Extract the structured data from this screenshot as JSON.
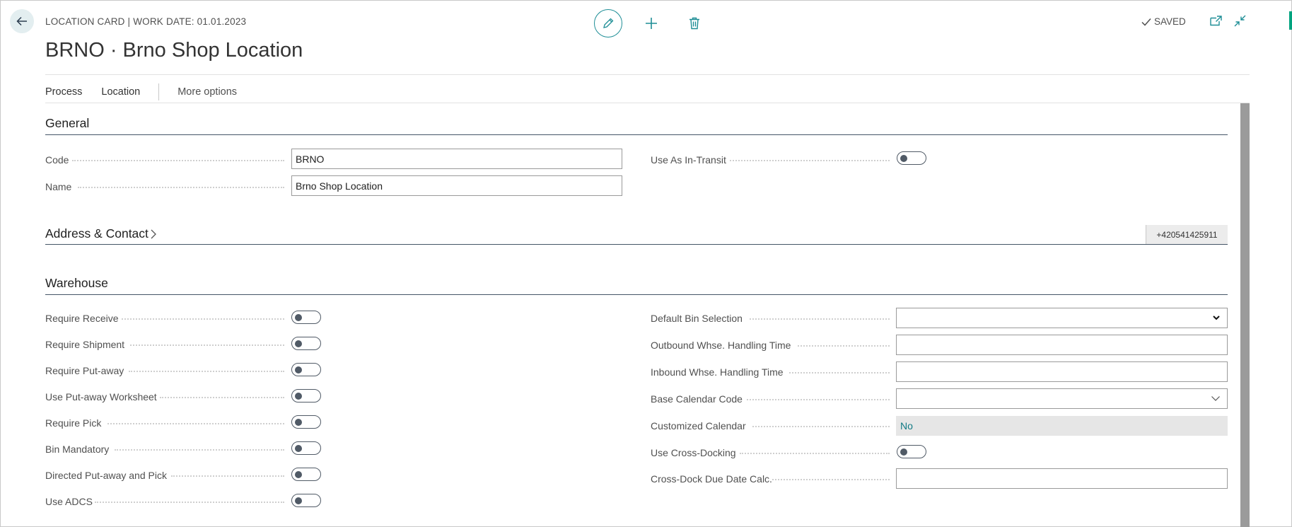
{
  "header": {
    "caption": "LOCATION CARD | WORK DATE: 01.01.2023",
    "title": "BRNO · Brno Shop Location",
    "status": "SAVED"
  },
  "icons": {
    "back": "arrow-left-icon",
    "edit": "pencil-icon",
    "new": "plus-icon",
    "delete": "trash-icon",
    "saved": "checkmark-icon",
    "open_new_window": "open-in-new-window-icon",
    "collapse": "collapse-icon",
    "dropdown": "chevron-down-icon",
    "expand": "chevron-right-icon"
  },
  "colors": {
    "accent": "#1e8e96",
    "section_line": "#445566",
    "link_value": "#127b85",
    "status_accent": "#00a37f"
  },
  "actionbar": {
    "process": "Process",
    "location": "Location",
    "more": "More options"
  },
  "general": {
    "title": "General",
    "code_label": "Code",
    "code_value": "BRNO",
    "name_label": "Name",
    "name_value": "Brno Shop Location",
    "in_transit_label": "Use As In-Transit",
    "in_transit_on": false
  },
  "address": {
    "title": "Address & Contact",
    "phone": "+420541425911"
  },
  "warehouse": {
    "title": "Warehouse",
    "left": [
      {
        "label": "Require Receive",
        "on": false
      },
      {
        "label": "Require Shipment",
        "on": false
      },
      {
        "label": "Require Put-away",
        "on": false
      },
      {
        "label": "Use Put-away Worksheet",
        "on": false
      },
      {
        "label": "Require Pick",
        "on": false
      },
      {
        "label": "Bin Mandatory",
        "on": false
      },
      {
        "label": "Directed Put-away and Pick",
        "on": false
      },
      {
        "label": "Use ADCS",
        "on": false
      }
    ],
    "right": {
      "default_bin_selection": {
        "label": "Default Bin Selection",
        "value": ""
      },
      "outbound_handling": {
        "label": "Outbound Whse. Handling Time",
        "value": ""
      },
      "inbound_handling": {
        "label": "Inbound Whse. Handling Time",
        "value": ""
      },
      "base_calendar": {
        "label": "Base Calendar Code",
        "value": ""
      },
      "customized_calendar": {
        "label": "Customized Calendar",
        "value": "No"
      },
      "cross_docking": {
        "label": "Use Cross-Docking",
        "on": false
      },
      "cross_dock_due": {
        "label": "Cross-Dock Due Date Calc.",
        "value": ""
      }
    }
  }
}
